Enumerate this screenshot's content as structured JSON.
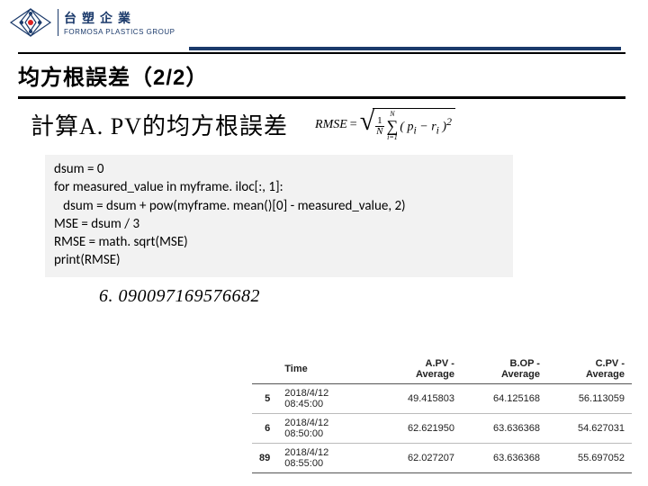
{
  "brand": {
    "cn": "台塑企業",
    "en": "FORMOSA PLASTICS GROUP"
  },
  "title": "均方根誤差（2/2）",
  "subtitle": "計算A. PV的均方根誤差",
  "formula": {
    "lhs": "RMSE",
    "eq": "=",
    "frac_num": "1",
    "frac_den": "N",
    "sum_top": "N",
    "sum_bot": "i=1",
    "term": "( p",
    "term_sub_i": "i",
    "term_mid": " − r",
    "term_sub_i2": "i",
    "term_end": " )",
    "power": "2"
  },
  "code": {
    "l1": "dsum = 0",
    "l2": "for measured_value in myframe. iloc[:, 1]:",
    "l3": "   dsum = dsum + pow(myframe. mean()[0] - measured_value, 2)",
    "l4": "MSE = dsum / 3",
    "l5": "RMSE = math. sqrt(MSE)",
    "l6": "print(RMSE)"
  },
  "output": "6. 090097169576682",
  "table": {
    "headers": [
      "",
      "Time",
      "A.PV - Average",
      "B.OP - Average",
      "C.PV - Average"
    ],
    "rows": [
      [
        "5",
        "2018/4/12 08:45:00",
        "49.415803",
        "64.125168",
        "56.113059"
      ],
      [
        "6",
        "2018/4/12 08:50:00",
        "62.621950",
        "63.636368",
        "54.627031"
      ],
      [
        "89",
        "2018/4/12 08:55:00",
        "62.027207",
        "63.636368",
        "55.697052"
      ]
    ]
  }
}
